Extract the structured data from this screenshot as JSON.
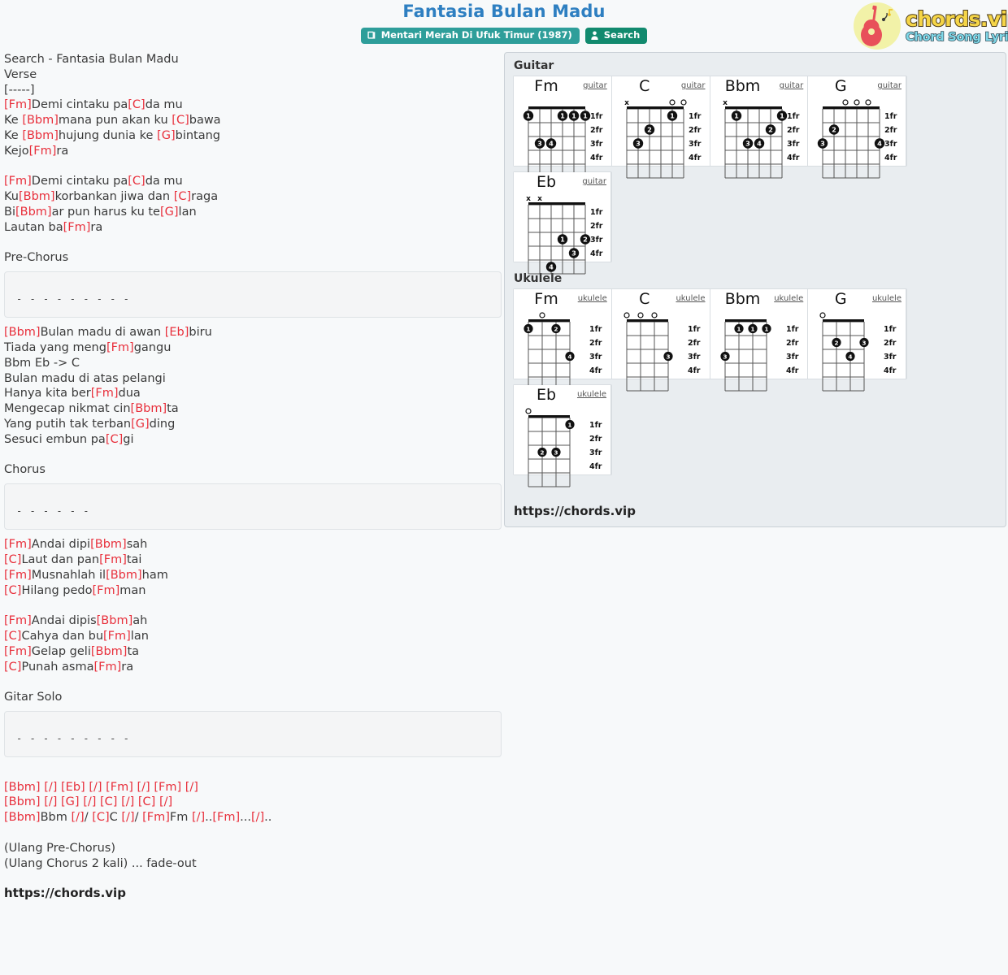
{
  "header": {
    "title": "Fantasia Bulan Madu",
    "album_badge": "Mentari Merah Di Ufuk Timur (1987)",
    "search_badge": "Search",
    "album_icon": "book-icon",
    "search_icon": "user-icon",
    "logo_main": "chords.vip",
    "logo_sub": "Chord Song Lyric",
    "logo_icon": "guitar-icon"
  },
  "colors": {
    "title": "#2e7fc1",
    "chord": "#e8303c",
    "album_badge": "#2e9e9a",
    "search_badge": "#128a6e",
    "panel_bg": "#e9edf0",
    "logo_circle": "#f2f2a8"
  },
  "lyrics": {
    "lines": [
      {
        "text": "Search - Fantasia Bulan Madu"
      },
      {
        "text": "Verse"
      },
      {
        "text": "[-----]"
      },
      {
        "text": "[Fm]Demi cintaku pa[C]da mu"
      },
      {
        "text": "Ke [Bbm]mana pun akan ku [C]bawa"
      },
      {
        "text": "Ke [Bbm]hujung dunia ke [G]bintang"
      },
      {
        "text": "Kejo[Fm]ra"
      },
      {
        "text": ""
      },
      {
        "text": "[Fm]Demi cintaku pa[C]da mu"
      },
      {
        "text": "Ku[Bbm]korbankan jiwa dan [C]raga"
      },
      {
        "text": "Bi[Bbm]ar pun harus ku te[G]lan"
      },
      {
        "text": "Lautan ba[Fm]ra"
      },
      {
        "text": ""
      },
      {
        "text": "Pre-Chorus"
      }
    ],
    "tab_box_1": "- - - - - - - - -",
    "lines2": [
      {
        "text": "[Bbm]Bulan madu di awan [Eb]biru"
      },
      {
        "text": "Tiada yang meng[Fm]gangu"
      },
      {
        "text": "Bbm Eb -> C"
      },
      {
        "text": "Bulan madu di atas pelangi"
      },
      {
        "text": "Hanya kita ber[Fm]dua"
      },
      {
        "text": "Mengecap nikmat cin[Bbm]ta"
      },
      {
        "text": "Yang putih tak terban[G]ding"
      },
      {
        "text": "Sesuci embun pa[C]gi"
      },
      {
        "text": ""
      },
      {
        "text": "Chorus"
      }
    ],
    "tab_box_2": "- - - - - -",
    "lines3": [
      {
        "text": "[Fm]Andai dipi[Bbm]sah"
      },
      {
        "text": "[C]Laut dan pan[Fm]tai"
      },
      {
        "text": "[Fm]Musnahlah il[Bbm]ham"
      },
      {
        "text": "[C]Hilang pedo[Fm]man"
      },
      {
        "text": ""
      },
      {
        "text": "[Fm]Andai dipis[Bbm]ah"
      },
      {
        "text": "[C]Cahya dan bu[Fm]lan"
      },
      {
        "text": "[Fm]Gelap geli[Bbm]ta"
      },
      {
        "text": "[C]Punah asma[Fm]ra"
      },
      {
        "text": ""
      },
      {
        "text": "Gitar Solo"
      }
    ],
    "tab_box_3": "- - - - - - - - -",
    "lines4": [
      {
        "text": ""
      },
      {
        "text": "[Bbm] [/] [Eb] [/] [Fm] [/] [Fm] [/]"
      },
      {
        "text": "[Bbm] [/] [G] [/] [C] [/] [C] [/]"
      },
      {
        "text": "[Bbm]Bbm [/]/ [C]C [/]/ [Fm]Fm [/]..[Fm]...[/].."
      },
      {
        "text": ""
      },
      {
        "text": "(Ulang Pre-Chorus)"
      },
      {
        "text": "(Ulang Chorus 2 kali) ... fade-out"
      }
    ],
    "footer_url": "https://chords.vip"
  },
  "chords": {
    "guitar_section": "Guitar",
    "ukulele_section": "Ukulele",
    "panel_url": "https://chords.vip",
    "fret_labels": [
      "1fr",
      "2fr",
      "3fr",
      "4fr"
    ],
    "guitar": [
      {
        "name": "Fm",
        "type": "guitar",
        "strings": 6,
        "markers": [
          "",
          "",
          "",
          "",
          "",
          ""
        ],
        "dots": [
          {
            "string": 6,
            "fret": 1,
            "finger": "1"
          },
          {
            "string": 3,
            "fret": 1,
            "finger": "1"
          },
          {
            "string": 2,
            "fret": 1,
            "finger": "1"
          },
          {
            "string": 1,
            "fret": 1,
            "finger": "1"
          },
          {
            "string": 5,
            "fret": 3,
            "finger": "3"
          },
          {
            "string": 4,
            "fret": 3,
            "finger": "4"
          }
        ]
      },
      {
        "name": "C",
        "type": "guitar",
        "strings": 6,
        "markers": [
          "x",
          "",
          "",
          "",
          "o",
          "o"
        ],
        "dots": [
          {
            "string": 2,
            "fret": 1,
            "finger": "1"
          },
          {
            "string": 4,
            "fret": 2,
            "finger": "2"
          },
          {
            "string": 5,
            "fret": 3,
            "finger": "3"
          }
        ]
      },
      {
        "name": "Bbm",
        "type": "guitar",
        "strings": 6,
        "markers": [
          "x",
          "",
          "",
          "",
          "",
          ""
        ],
        "dots": [
          {
            "string": 5,
            "fret": 1,
            "finger": "1"
          },
          {
            "string": 1,
            "fret": 1,
            "finger": "1"
          },
          {
            "string": 2,
            "fret": 2,
            "finger": "2"
          },
          {
            "string": 4,
            "fret": 3,
            "finger": "3"
          },
          {
            "string": 3,
            "fret": 3,
            "finger": "4"
          }
        ]
      },
      {
        "name": "G",
        "type": "guitar",
        "strings": 6,
        "markers": [
          "",
          "",
          "o",
          "o",
          "o",
          ""
        ],
        "dots": [
          {
            "string": 5,
            "fret": 2,
            "finger": "2"
          },
          {
            "string": 6,
            "fret": 3,
            "finger": "3"
          },
          {
            "string": 1,
            "fret": 3,
            "finger": "4"
          }
        ]
      },
      {
        "name": "Eb",
        "type": "guitar",
        "strings": 6,
        "markers": [
          "x",
          "x",
          "",
          "",
          "",
          ""
        ],
        "dots": [
          {
            "string": 3,
            "fret": 3,
            "finger": "1"
          },
          {
            "string": 1,
            "fret": 3,
            "finger": "2"
          },
          {
            "string": 2,
            "fret": 4,
            "finger": "3"
          },
          {
            "string": 4,
            "fret": 5,
            "finger": "4"
          }
        ]
      }
    ],
    "ukulele": [
      {
        "name": "Fm",
        "type": "ukulele",
        "strings": 4,
        "markers": [
          "",
          "o",
          "",
          ""
        ],
        "dots": [
          {
            "string": 4,
            "fret": 1,
            "finger": "1"
          },
          {
            "string": 2,
            "fret": 1,
            "finger": "2"
          },
          {
            "string": 1,
            "fret": 3,
            "finger": "4"
          }
        ]
      },
      {
        "name": "C",
        "type": "ukulele",
        "strings": 4,
        "markers": [
          "o",
          "o",
          "o",
          ""
        ],
        "dots": [
          {
            "string": 1,
            "fret": 3,
            "finger": "3"
          }
        ]
      },
      {
        "name": "Bbm",
        "type": "ukulele",
        "strings": 4,
        "markers": [
          "",
          "",
          "",
          ""
        ],
        "dots": [
          {
            "string": 3,
            "fret": 1,
            "finger": "1"
          },
          {
            "string": 2,
            "fret": 1,
            "finger": "1"
          },
          {
            "string": 1,
            "fret": 1,
            "finger": "1"
          },
          {
            "string": 4,
            "fret": 3,
            "finger": "3"
          }
        ]
      },
      {
        "name": "G",
        "type": "ukulele",
        "strings": 4,
        "markers": [
          "o",
          "",
          "",
          ""
        ],
        "dots": [
          {
            "string": 3,
            "fret": 2,
            "finger": "2"
          },
          {
            "string": 1,
            "fret": 2,
            "finger": "3"
          },
          {
            "string": 2,
            "fret": 3,
            "finger": "4"
          }
        ]
      },
      {
        "name": "Eb",
        "type": "ukulele",
        "strings": 4,
        "markers": [
          "o",
          "",
          "",
          ""
        ],
        "dots": [
          {
            "string": 1,
            "fret": 1,
            "finger": "1"
          },
          {
            "string": 3,
            "fret": 3,
            "finger": "2"
          },
          {
            "string": 2,
            "fret": 3,
            "finger": "3"
          }
        ]
      }
    ]
  }
}
